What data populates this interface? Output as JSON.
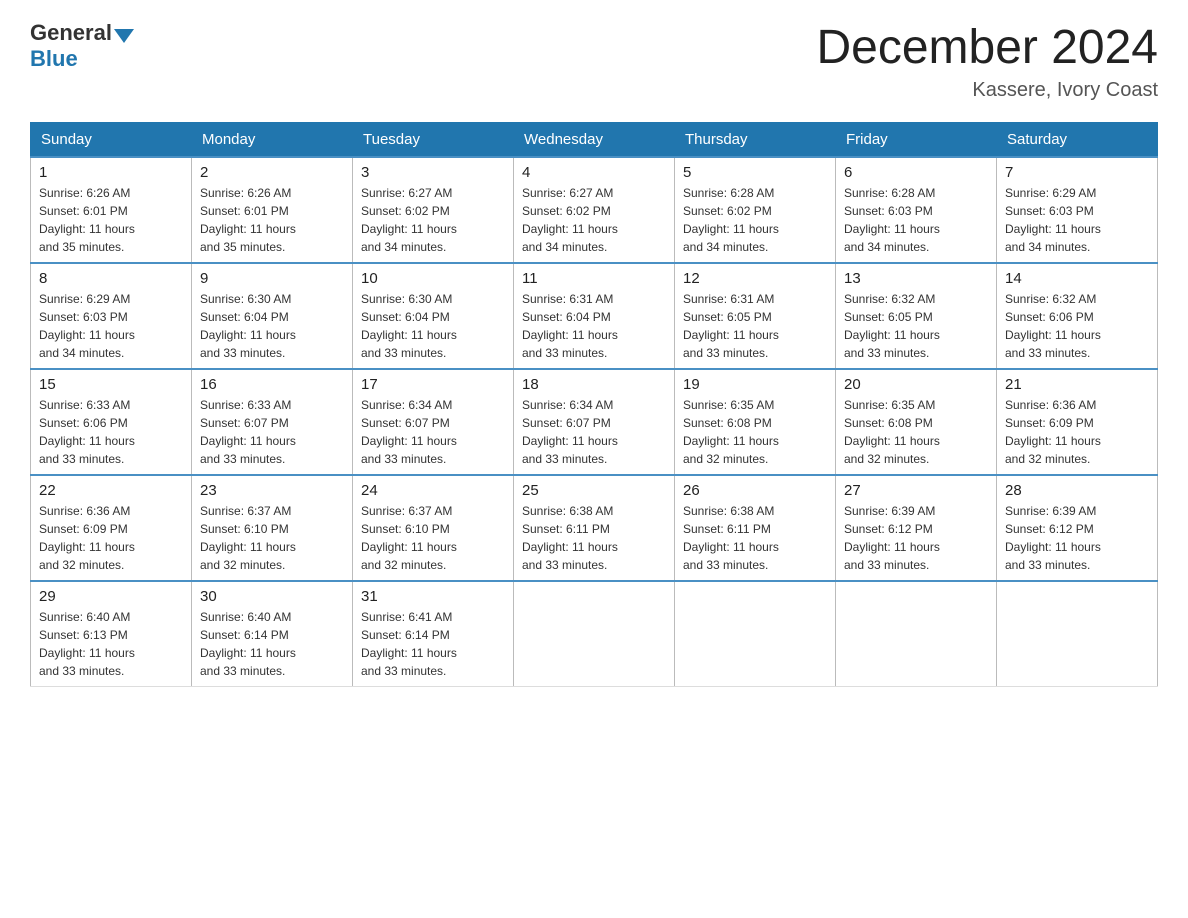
{
  "header": {
    "logo_general": "General",
    "logo_blue": "Blue",
    "month_title": "December 2024",
    "location": "Kassere, Ivory Coast"
  },
  "weekdays": [
    "Sunday",
    "Monday",
    "Tuesday",
    "Wednesday",
    "Thursday",
    "Friday",
    "Saturday"
  ],
  "weeks": [
    [
      {
        "day": "1",
        "sunrise": "6:26 AM",
        "sunset": "6:01 PM",
        "daylight": "11 hours and 35 minutes."
      },
      {
        "day": "2",
        "sunrise": "6:26 AM",
        "sunset": "6:01 PM",
        "daylight": "11 hours and 35 minutes."
      },
      {
        "day": "3",
        "sunrise": "6:27 AM",
        "sunset": "6:02 PM",
        "daylight": "11 hours and 34 minutes."
      },
      {
        "day": "4",
        "sunrise": "6:27 AM",
        "sunset": "6:02 PM",
        "daylight": "11 hours and 34 minutes."
      },
      {
        "day": "5",
        "sunrise": "6:28 AM",
        "sunset": "6:02 PM",
        "daylight": "11 hours and 34 minutes."
      },
      {
        "day": "6",
        "sunrise": "6:28 AM",
        "sunset": "6:03 PM",
        "daylight": "11 hours and 34 minutes."
      },
      {
        "day": "7",
        "sunrise": "6:29 AM",
        "sunset": "6:03 PM",
        "daylight": "11 hours and 34 minutes."
      }
    ],
    [
      {
        "day": "8",
        "sunrise": "6:29 AM",
        "sunset": "6:03 PM",
        "daylight": "11 hours and 34 minutes."
      },
      {
        "day": "9",
        "sunrise": "6:30 AM",
        "sunset": "6:04 PM",
        "daylight": "11 hours and 33 minutes."
      },
      {
        "day": "10",
        "sunrise": "6:30 AM",
        "sunset": "6:04 PM",
        "daylight": "11 hours and 33 minutes."
      },
      {
        "day": "11",
        "sunrise": "6:31 AM",
        "sunset": "6:04 PM",
        "daylight": "11 hours and 33 minutes."
      },
      {
        "day": "12",
        "sunrise": "6:31 AM",
        "sunset": "6:05 PM",
        "daylight": "11 hours and 33 minutes."
      },
      {
        "day": "13",
        "sunrise": "6:32 AM",
        "sunset": "6:05 PM",
        "daylight": "11 hours and 33 minutes."
      },
      {
        "day": "14",
        "sunrise": "6:32 AM",
        "sunset": "6:06 PM",
        "daylight": "11 hours and 33 minutes."
      }
    ],
    [
      {
        "day": "15",
        "sunrise": "6:33 AM",
        "sunset": "6:06 PM",
        "daylight": "11 hours and 33 minutes."
      },
      {
        "day": "16",
        "sunrise": "6:33 AM",
        "sunset": "6:07 PM",
        "daylight": "11 hours and 33 minutes."
      },
      {
        "day": "17",
        "sunrise": "6:34 AM",
        "sunset": "6:07 PM",
        "daylight": "11 hours and 33 minutes."
      },
      {
        "day": "18",
        "sunrise": "6:34 AM",
        "sunset": "6:07 PM",
        "daylight": "11 hours and 33 minutes."
      },
      {
        "day": "19",
        "sunrise": "6:35 AM",
        "sunset": "6:08 PM",
        "daylight": "11 hours and 32 minutes."
      },
      {
        "day": "20",
        "sunrise": "6:35 AM",
        "sunset": "6:08 PM",
        "daylight": "11 hours and 32 minutes."
      },
      {
        "day": "21",
        "sunrise": "6:36 AM",
        "sunset": "6:09 PM",
        "daylight": "11 hours and 32 minutes."
      }
    ],
    [
      {
        "day": "22",
        "sunrise": "6:36 AM",
        "sunset": "6:09 PM",
        "daylight": "11 hours and 32 minutes."
      },
      {
        "day": "23",
        "sunrise": "6:37 AM",
        "sunset": "6:10 PM",
        "daylight": "11 hours and 32 minutes."
      },
      {
        "day": "24",
        "sunrise": "6:37 AM",
        "sunset": "6:10 PM",
        "daylight": "11 hours and 32 minutes."
      },
      {
        "day": "25",
        "sunrise": "6:38 AM",
        "sunset": "6:11 PM",
        "daylight": "11 hours and 33 minutes."
      },
      {
        "day": "26",
        "sunrise": "6:38 AM",
        "sunset": "6:11 PM",
        "daylight": "11 hours and 33 minutes."
      },
      {
        "day": "27",
        "sunrise": "6:39 AM",
        "sunset": "6:12 PM",
        "daylight": "11 hours and 33 minutes."
      },
      {
        "day": "28",
        "sunrise": "6:39 AM",
        "sunset": "6:12 PM",
        "daylight": "11 hours and 33 minutes."
      }
    ],
    [
      {
        "day": "29",
        "sunrise": "6:40 AM",
        "sunset": "6:13 PM",
        "daylight": "11 hours and 33 minutes."
      },
      {
        "day": "30",
        "sunrise": "6:40 AM",
        "sunset": "6:14 PM",
        "daylight": "11 hours and 33 minutes."
      },
      {
        "day": "31",
        "sunrise": "6:41 AM",
        "sunset": "6:14 PM",
        "daylight": "11 hours and 33 minutes."
      },
      null,
      null,
      null,
      null
    ]
  ],
  "labels": {
    "sunrise_prefix": "Sunrise: ",
    "sunset_prefix": "Sunset: ",
    "daylight_prefix": "Daylight: "
  }
}
